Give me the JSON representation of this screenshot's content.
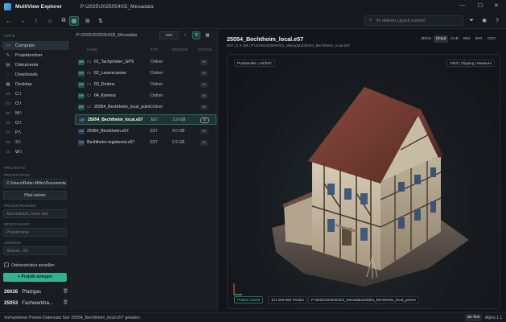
{
  "app": {
    "title": "MultiView Explorer",
    "window_path": "P:\\2025\\2025054\\02_Mesadata"
  },
  "window_controls": {
    "min": "—",
    "max": "☐",
    "close": "✕"
  },
  "toolbar": {
    "back_icon": "←",
    "forward_icon": "→",
    "up_icon": "↑",
    "home_icon": "⌂",
    "copy_icon": "⧉",
    "layout_icon": "▦",
    "layout2_icon": "⊞",
    "sync_icon": "⇅",
    "search_placeholder": "Im aktiven Layout suchen",
    "filter_icon": "⏷",
    "theme_icon": "✺",
    "help_icon": "?"
  },
  "sidebar": {
    "sec_orte": "ORTE",
    "items": [
      {
        "icon": "▭",
        "label": "Computer",
        "selected": true
      },
      {
        "icon": "✎",
        "label": "Projektordner"
      },
      {
        "icon": "▤",
        "label": "Dokumente"
      },
      {
        "icon": "↓",
        "label": "Downloads"
      },
      {
        "icon": "▦",
        "label": "Desktop"
      },
      {
        "icon": "▭",
        "label": "C:\\"
      },
      {
        "icon": "▭",
        "label": "O:\\"
      },
      {
        "icon": "▭",
        "label": "M:\\"
      },
      {
        "icon": "▭",
        "label": "O:\\"
      },
      {
        "icon": "▭",
        "label": "P:\\"
      },
      {
        "icon": "▭",
        "label": "S:\\"
      },
      {
        "icon": "▭",
        "label": "W:\\"
      }
    ],
    "sec_projekte": "PROJEKTE",
    "lbl_projektpfad": "PROJEKTPFAD",
    "projektpfad_value": "C:\\Users\\Robin Miller\\Documents\\",
    "btn_pfad_setzen": "Pfad setzen",
    "lbl_projektnummer": "PROJEKTNUMMER",
    "projektnummer_ph": "Automatisch, wenn leer",
    "lbl_bezeichnung": "BEZEICHNUNG",
    "bezeichnung_ph": "Projektname",
    "lbl_adresse": "ADRESSE",
    "adresse_ph": "Strasse, Ort",
    "checkbox_label": "Ordnerstruktur anstellen",
    "btn_projekt_anlegen": "+ Projekt anlegen",
    "projects": [
      {
        "num": "26026",
        "name": "Pfalzgas",
        "del": "🗑"
      },
      {
        "num": "25053",
        "name": "Fachwerkha...",
        "del": "🗑"
      }
    ]
  },
  "filepane": {
    "path": "P:\\2025\\2025054\\02_Mesadata",
    "sort_label": "Sort",
    "up_icon": "↑",
    "list_icon": "☰",
    "grid_icon": "▦",
    "columns": {
      "name": "NAME",
      "type": "TYP",
      "size": "GRÖSSE",
      "status": "STATUS"
    },
    "rows": [
      {
        "badge": "DIR",
        "kind": "dir",
        "icon": "▭",
        "name": "01_Tachymeter_GPS",
        "type": "Ordner",
        "size": "",
        "status": "Dir"
      },
      {
        "badge": "DIR",
        "kind": "dir",
        "icon": "▭",
        "name": "02_Laserscanner",
        "type": "Ordner",
        "size": "",
        "status": "Dir"
      },
      {
        "badge": "DIR",
        "kind": "dir",
        "icon": "▭",
        "name": "03_Drohne",
        "type": "Ordner",
        "size": "",
        "status": "Dir"
      },
      {
        "badge": "DIR",
        "kind": "dir",
        "icon": "▭",
        "name": "04_Kamera",
        "type": "Ordner",
        "size": "",
        "status": "Dir"
      },
      {
        "badge": "DIR",
        "kind": "dir",
        "icon": "▭",
        "name": "25054_Bechtheim_local_pointse",
        "type": "Ordner",
        "size": "",
        "status": "Dir"
      },
      {
        "badge": "LAS",
        "kind": "file",
        "icon": "",
        "name": "25054_Bechtheim_local.e57",
        "type": "E57",
        "size": "2.9 GB",
        "status": "3D",
        "selected": true
      },
      {
        "badge": "LAS",
        "kind": "file",
        "icon": "",
        "name": "25054_Bechtheim.e57",
        "type": "E57",
        "size": "4.0 GB",
        "status": "3D"
      },
      {
        "badge": "LAS",
        "kind": "file",
        "icon": "",
        "name": "Bechtheim registered.e57",
        "type": "E57",
        "size": "2.9 GB",
        "status": "3D"
      }
    ]
  },
  "viewer": {
    "title": "25054_Bechtheim_local.e57",
    "subtitle": "E57 | 2.9 GB | P:\\2025\\2025054\\02_Mesadata\\25054_Bechtheim_local.e57",
    "tabs": [
      "3DGS",
      "Cloud",
      "CAD",
      "BIM",
      "IMG",
      "DOC"
    ],
    "active_tab": "Cloud",
    "overlay_top_left": "Punktwolke LAS/E57",
    "overlay_top_right": "Orbit | Clipping | Measure",
    "overlay_bottom_left": "Potree-Cache",
    "overlay_points": "101.263.892 Punkte",
    "overlay_path": "P:\\2025\\2025054\\02_Mesadata\\25054_Bechtheim_local_potree"
  },
  "statusbar": {
    "message": "Vorhandener Potree-Datensatz fuer 25054_Bechtheim_local.e57 geladen.",
    "mode": "3D-first",
    "version": "Alpha 1.1"
  }
}
